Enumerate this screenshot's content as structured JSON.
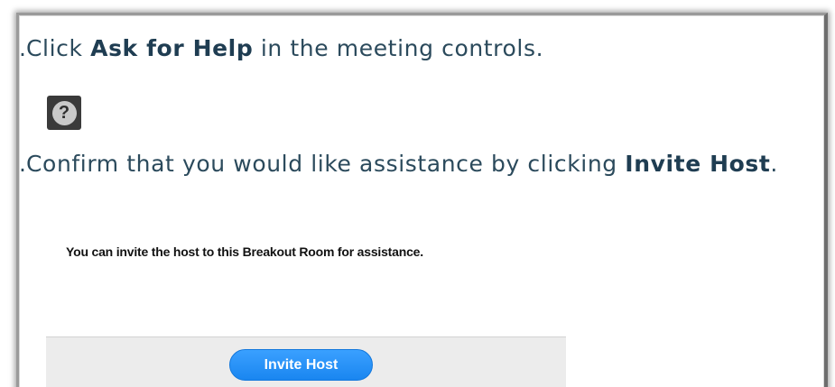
{
  "instructions": {
    "step_1": {
      "marker": ".",
      "text_before": "Click ",
      "emphasis": "Ask for Help",
      "text_after": " in the meeting controls."
    },
    "step_2": {
      "marker": ".",
      "text_before": "Confirm that you would like assistance by clicking ",
      "emphasis": "Invite Host",
      "text_after": "."
    }
  },
  "help_icon": {
    "icon": "question-mark-icon",
    "glyph": "?"
  },
  "dialog": {
    "message": "You can invite the host to this Breakout Room for assistance.",
    "invite_button_label": "Invite Host"
  },
  "colors": {
    "instruction_text": "#2b4a5c",
    "button_blue": "#1a86f0",
    "footer_gray": "#ececec"
  }
}
